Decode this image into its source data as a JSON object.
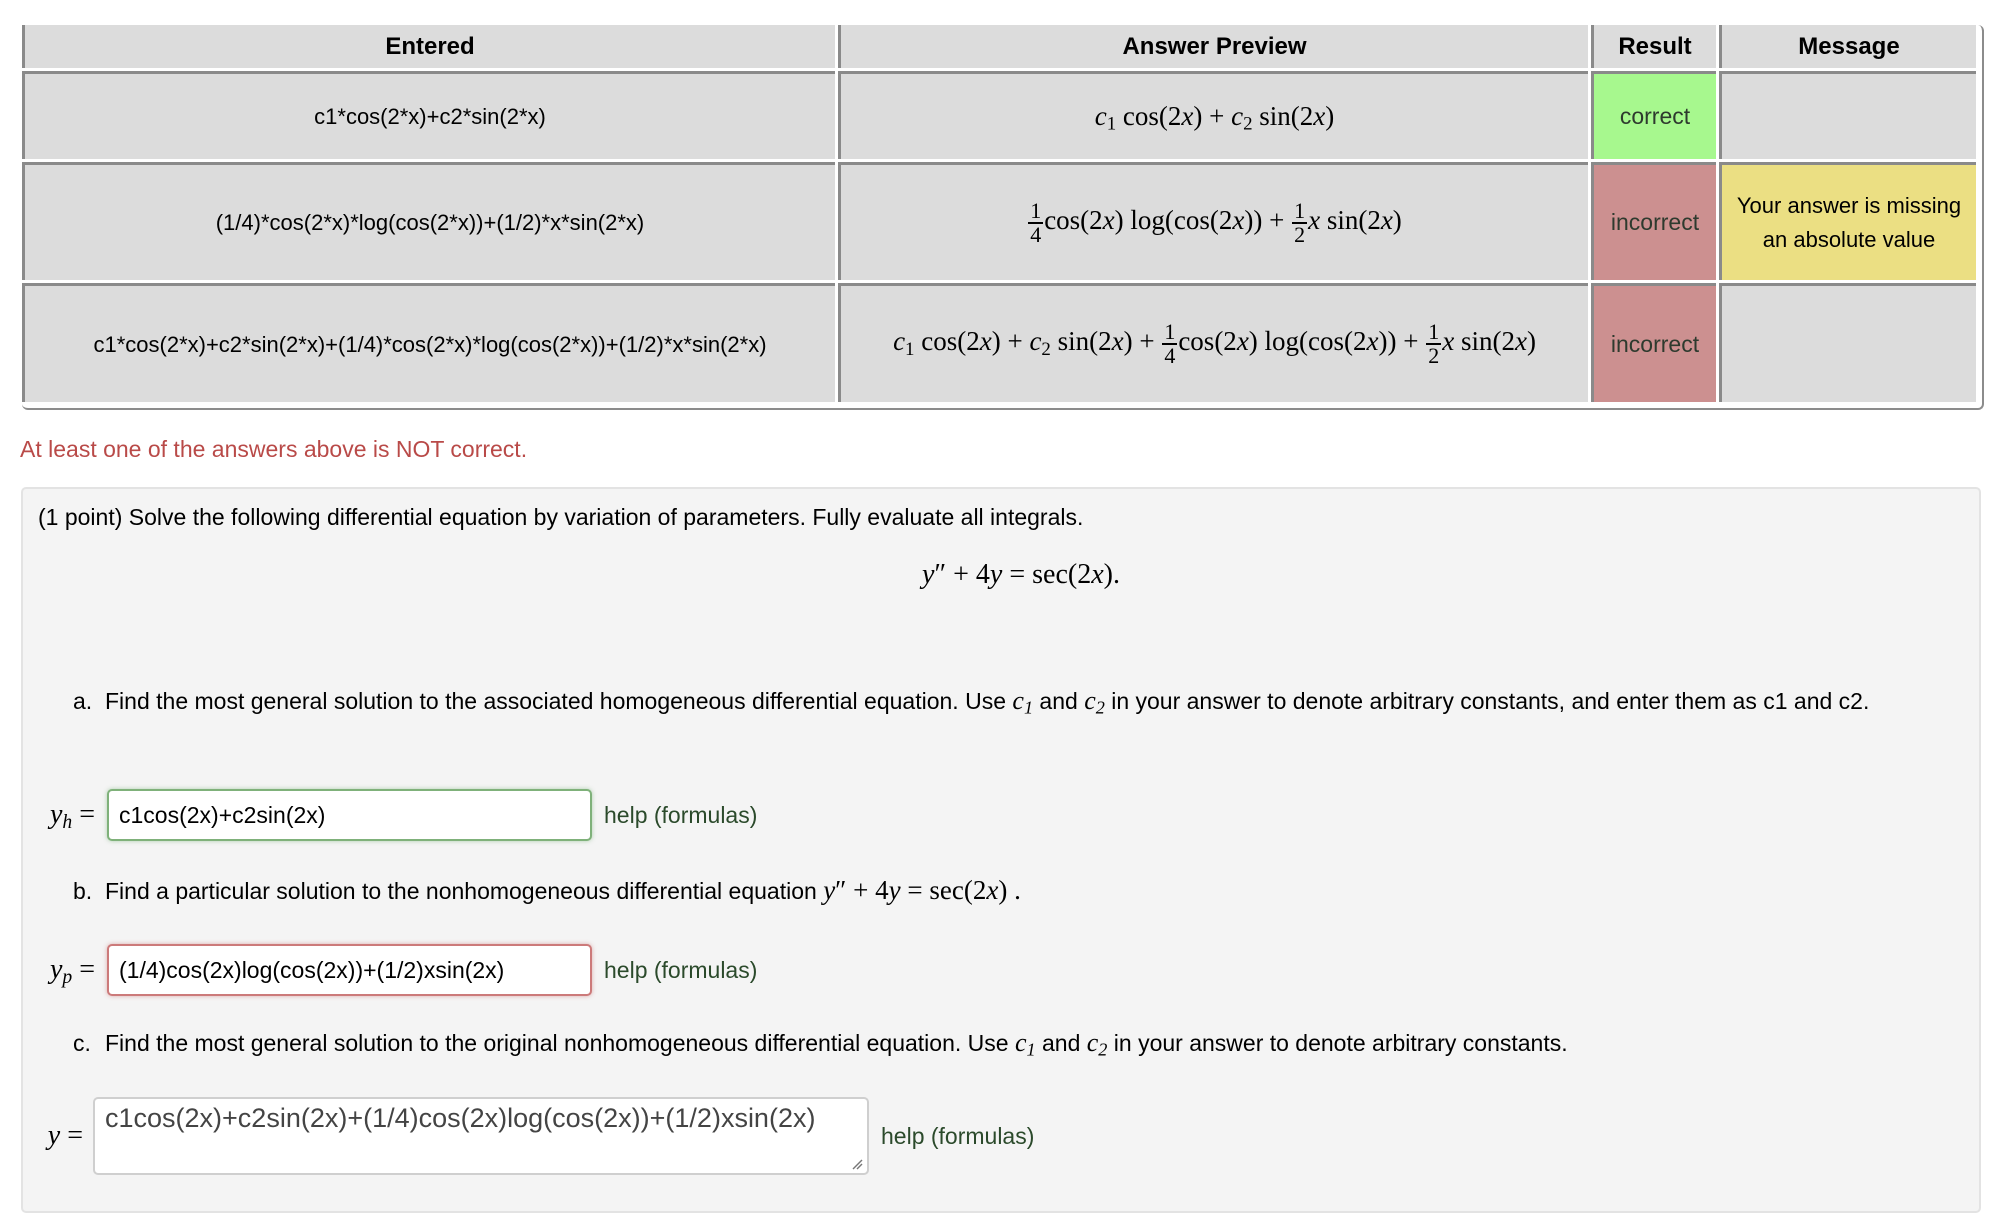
{
  "results_table": {
    "headers": [
      "Entered",
      "Answer Preview",
      "Result",
      "Message"
    ],
    "rows": [
      {
        "entered": "c1*cos(2*x)+c2*sin(2*x)",
        "preview": "c₁ cos(2x) + c₂ sin(2x)",
        "result": "correct",
        "message": ""
      },
      {
        "entered": "(1/4)*cos(2*x)*log(cos(2*x))+(1/2)*x*sin(2*x)",
        "preview": "1/4 cos(2x) log(cos(2x)) + 1/2 x sin(2x)",
        "result": "incorrect",
        "message": "Your answer is missing an absolute value"
      },
      {
        "entered": "c1*cos(2*x)+c2*sin(2*x)+(1/4)*cos(2*x)*log(cos(2*x))+(1/2)*x*sin(2*x)",
        "preview": "c₁ cos(2x) + c₂ sin(2x) + 1/4 cos(2x) log(cos(2x)) + 1/2 x sin(2x)",
        "result": "incorrect",
        "message": ""
      }
    ]
  },
  "status_message": "At least one of the answers above is NOT correct.",
  "status_color": "#b94a48",
  "problem": {
    "intro": "(1 point) Solve the following differential equation by variation of parameters. Fully evaluate all integrals.",
    "equation": "y″ + 4y = sec(2x).",
    "parts": [
      {
        "label": "a.",
        "text_before": "Find the most general solution to the associated homogeneous differential equation. Use",
        "text_mid": "and",
        "text_after": "in your answer to denote arbitrary constants, and enter them as c1 and c2.",
        "var": "y_h",
        "answer": "c1cos(2x)+c2sin(2x)",
        "state": "correct",
        "help": "help (formulas)"
      },
      {
        "label": "b.",
        "text_before": "Find a particular solution to the nonhomogeneous differential equation",
        "equation": "y″ + 4y = sec(2x) .",
        "var": "y_p",
        "answer": "(1/4)cos(2x)log(cos(2x))+(1/2)xsin(2x)",
        "state": "incorrect",
        "help": "help (formulas)"
      },
      {
        "label": "c.",
        "text_before": "Find the most general solution to the original nonhomogeneous differential equation. Use",
        "text_mid": "and",
        "text_after": "in your answer to denote arbitrary constants.",
        "var": "y",
        "answer": "c1cos(2x)+c2sin(2x)+(1/4)cos(2x)log(cos(2x))+(1/2)xsin(2x)",
        "state": "incorrect",
        "help": "help (formulas)"
      }
    ]
  },
  "colors": {
    "correct": "#a7f88e",
    "incorrect": "#cc9090",
    "message_warning": "#ebdf83",
    "cell_bg": "#dcdcdc"
  }
}
